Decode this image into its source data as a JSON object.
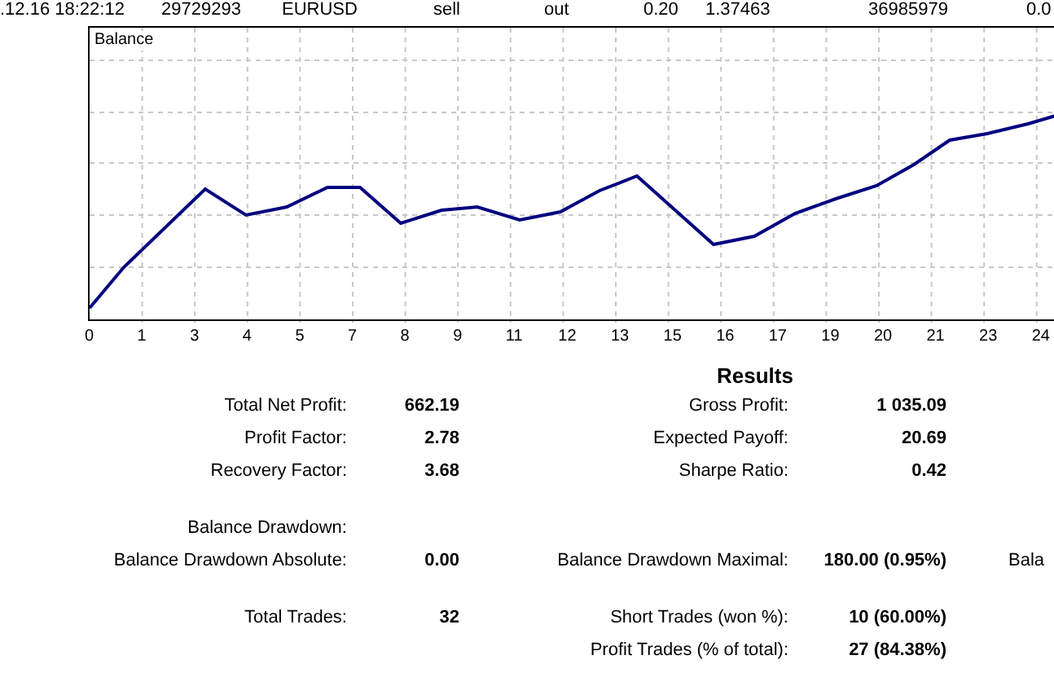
{
  "trade_row": {
    "cells": [
      ".12.16 18:22:12",
      "29729293",
      "EURUSD",
      "sell",
      "out",
      "0.20",
      "1.37463",
      "36985979",
      "0.0"
    ]
  },
  "chart": {
    "title": "Balance",
    "x_axis_labels": [
      "0",
      "1",
      "3",
      "4",
      "5",
      "7",
      "8",
      "9",
      "11",
      "12",
      "13",
      "15",
      "16",
      "17",
      "19",
      "20",
      "21",
      "23",
      "24"
    ]
  },
  "results": {
    "title": "Results",
    "groups": [
      {
        "rows": [
          [
            {
              "label": "Total Net Profit:",
              "value": "662.19"
            },
            {
              "label": "Gross Profit:",
              "value": "1 035.09"
            }
          ],
          [
            {
              "label": "Profit Factor:",
              "value": "2.78"
            },
            {
              "label": "Expected Payoff:",
              "value": "20.69"
            }
          ],
          [
            {
              "label": "Recovery Factor:",
              "value": "3.68"
            },
            {
              "label": "Sharpe Ratio:",
              "value": "0.42"
            }
          ]
        ]
      },
      {
        "rows": [
          [
            {
              "label": "Balance Drawdown:"
            }
          ],
          [
            {
              "label": "Balance Drawdown Absolute:",
              "value": "0.00"
            },
            {
              "label": "Balance Drawdown Maximal:",
              "value": "180.00 (0.95%)"
            },
            {
              "label": "Bala"
            }
          ]
        ]
      },
      {
        "rows": [
          [
            {
              "label": "Total Trades:",
              "value": "32"
            },
            {
              "label": "Short Trades (won %):",
              "value": "10 (60.00%)"
            }
          ],
          [
            {},
            {
              "label": "Profit Trades (% of total):",
              "value": "27 (84.38%)"
            }
          ]
        ]
      }
    ]
  }
}
